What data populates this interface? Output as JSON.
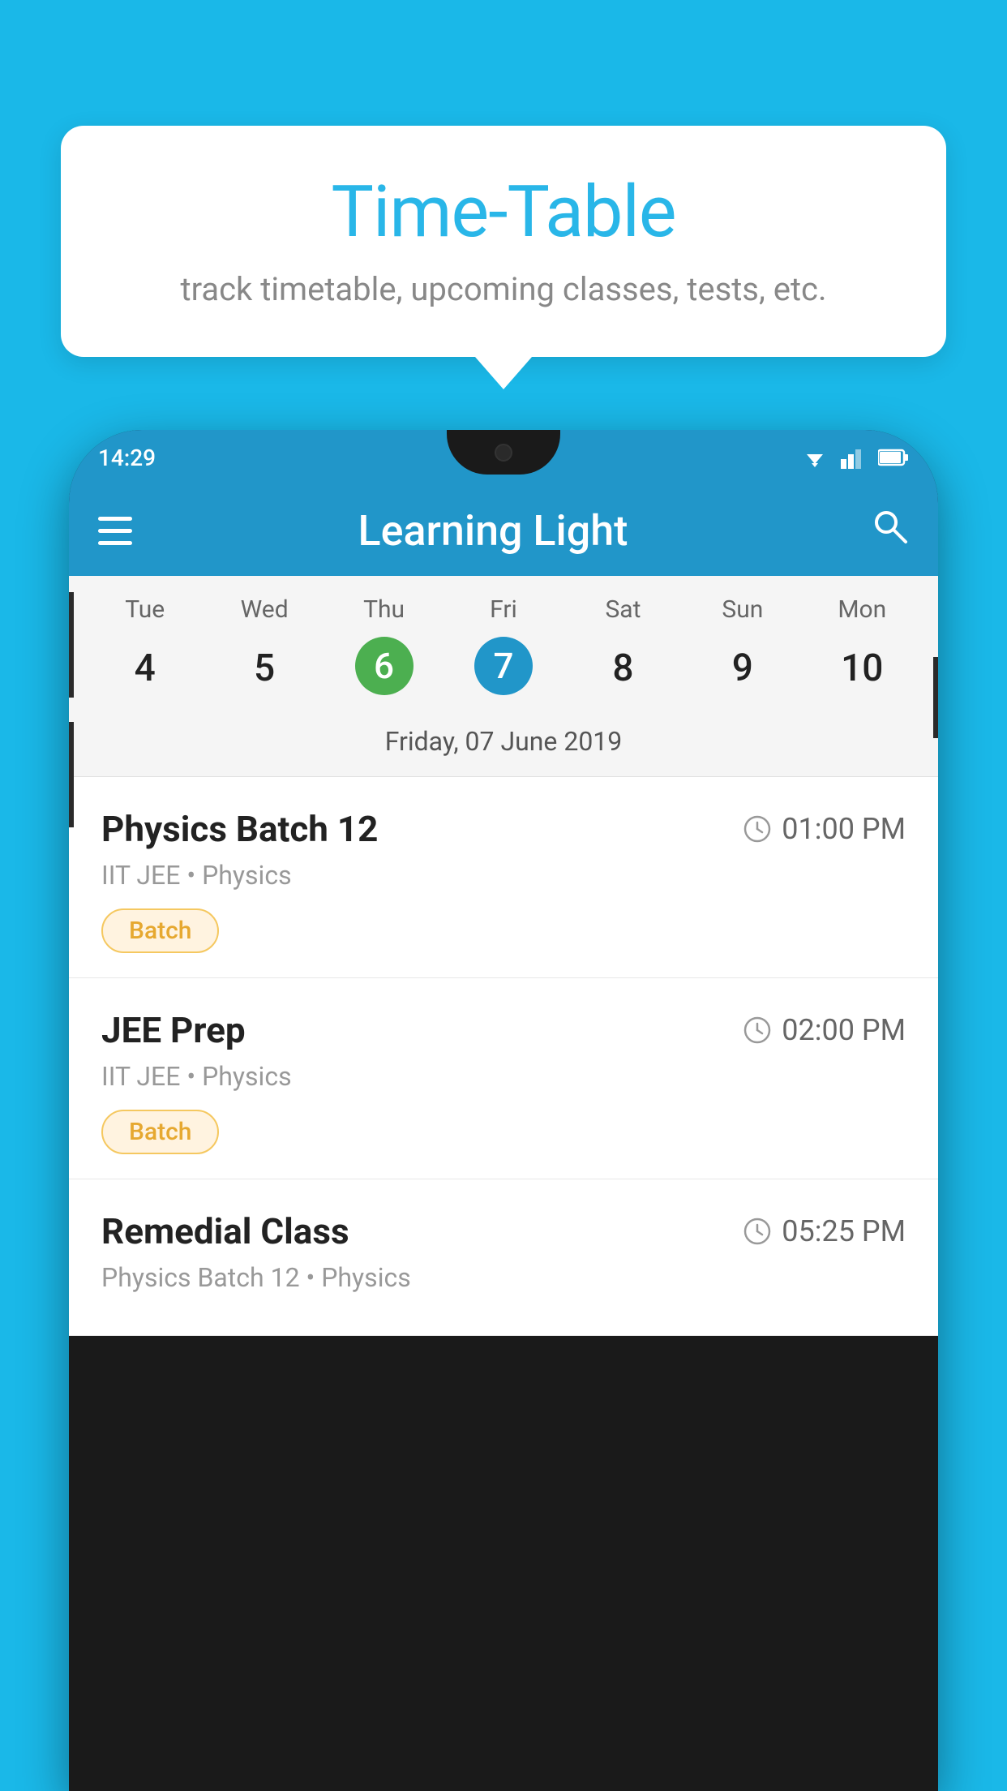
{
  "tooltip": {
    "title": "Time-Table",
    "subtitle": "track timetable, upcoming classes, tests, etc."
  },
  "phone": {
    "status_time": "14:29",
    "app_title": "Learning Light",
    "calendar": {
      "day_headers": [
        "Tue",
        "Wed",
        "Thu",
        "Fri",
        "Sat",
        "Sun",
        "Mon"
      ],
      "day_numbers": [
        "4",
        "5",
        "6",
        "7",
        "8",
        "9",
        "10"
      ],
      "today_index": 2,
      "selected_index": 3,
      "selected_date_label": "Friday, 07 June 2019"
    },
    "schedule": [
      {
        "title": "Physics Batch 12",
        "time": "01:00 PM",
        "subtitle": "IIT JEE • Physics",
        "badge": "Batch"
      },
      {
        "title": "JEE Prep",
        "time": "02:00 PM",
        "subtitle": "IIT JEE • Physics",
        "badge": "Batch"
      },
      {
        "title": "Remedial Class",
        "time": "05:25 PM",
        "subtitle": "Physics Batch 12 • Physics",
        "badge": ""
      }
    ]
  },
  "icons": {
    "hamburger": "☰",
    "search": "🔍",
    "clock": "🕐"
  }
}
